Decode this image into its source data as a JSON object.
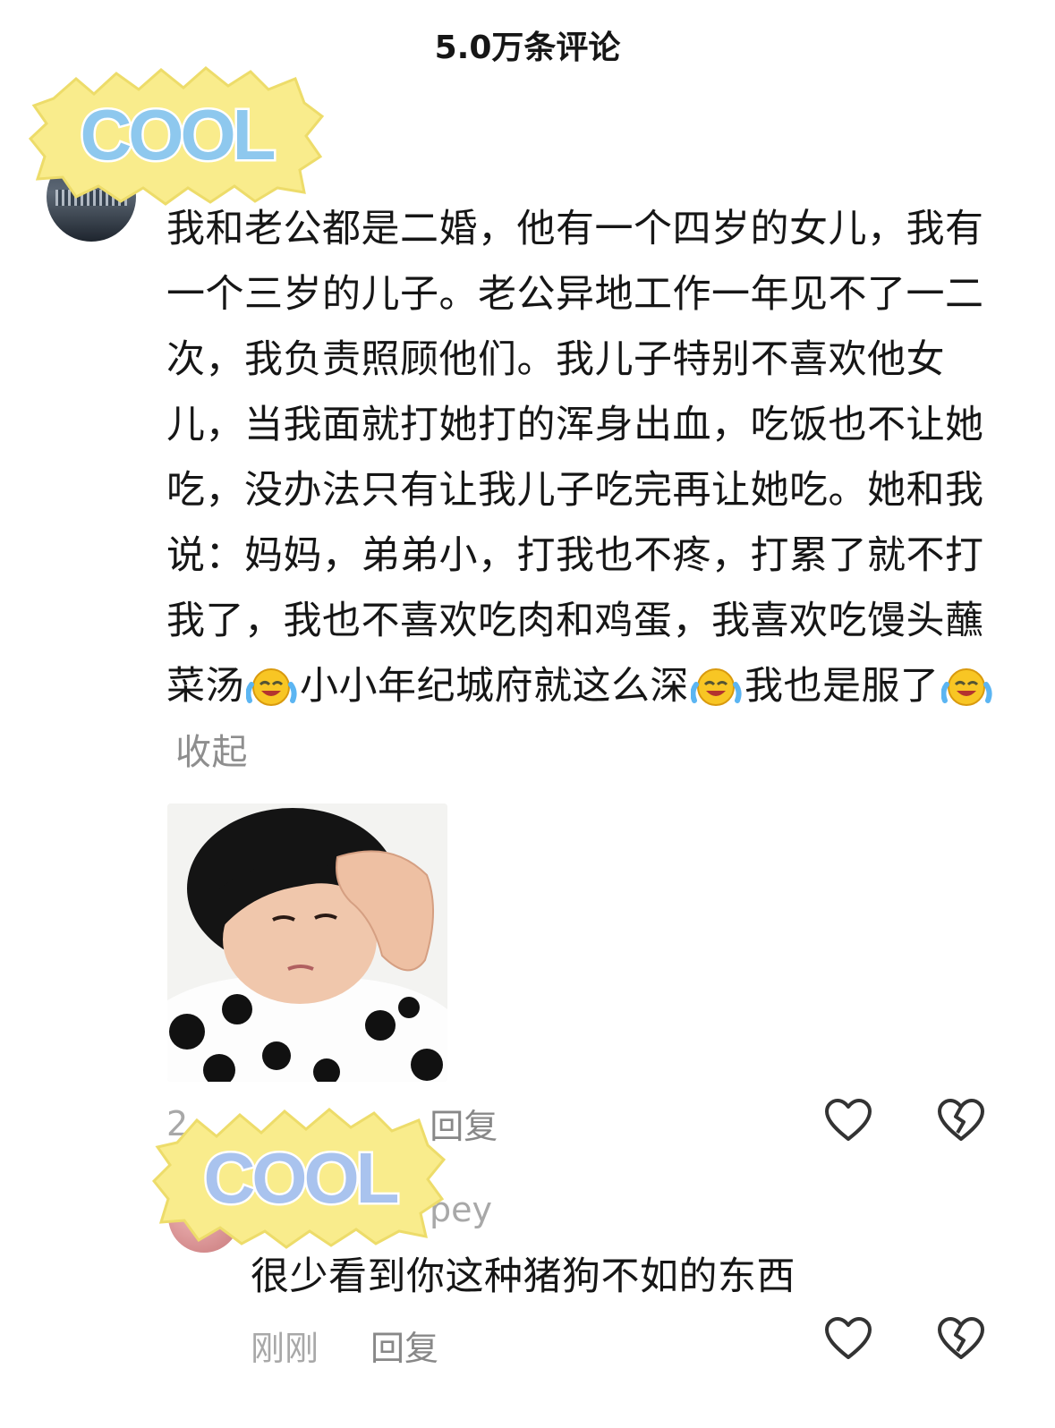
{
  "header": {
    "title": "5.0万条评论"
  },
  "stickers": {
    "text": "COOL"
  },
  "comment": {
    "text_before_emoji_1": "我和老公都是二婚，他有一个四岁的女儿，我有一个三岁的儿子。老公异地工作一年见不了一二次，我负责照顾他们。我儿子特别不喜欢他女儿，当我面就打她打的浑身出血，吃饭也不让她吃，没办法只有让我儿子吃完再让她吃。她和我说：妈妈，弟弟小，打我也不疼，打累了就不打我了，我也不喜欢吃肉和鸡蛋，我喜欢吃馒头蘸菜汤",
    "text_after_emoji_1": "小小年纪城府就这么深",
    "text_after_emoji_2": "我也是服了",
    "collapse_label": "收起",
    "emoji": "laughing-crying-emoji",
    "time_visible": "2",
    "reply_label": "回复"
  },
  "reply": {
    "username_visible": "pey",
    "text": "很少看到你这种猪狗不如的东西",
    "time": "刚刚",
    "reply_label": "回复"
  },
  "icons": {
    "like": "heart-icon",
    "dislike": "broken-heart-icon"
  },
  "colors": {
    "text": "#161616",
    "muted": "#a8a8a8",
    "sticker_bg": "#f9ec8c"
  }
}
